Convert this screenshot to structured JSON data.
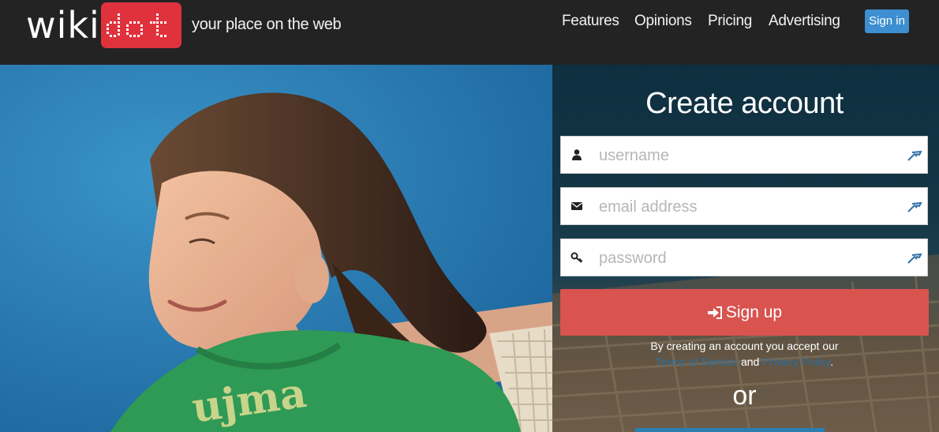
{
  "header": {
    "logo_wiki": "wiki",
    "logo_dot": "dot",
    "tagline": "your place on the web",
    "nav": [
      "Features",
      "Opinions",
      "Pricing",
      "Advertising"
    ],
    "signin_label": "Sign in"
  },
  "hero": {
    "shirt_text": "ujma"
  },
  "signup": {
    "title": "Create account",
    "username_placeholder": "username",
    "email_placeholder": "email address",
    "password_placeholder": "password",
    "button_label": "Sign up",
    "terms_text": "By creating an account you accept our",
    "terms_link": "Terms of Service",
    "terms_and": "and",
    "privacy_link": "Privacy Policy",
    "terms_end": ".",
    "or_text": "or"
  },
  "colors": {
    "header_bg": "#232323",
    "logo_red": "#e0323c",
    "signin_blue": "#3d8fd1",
    "signup_red": "#d9534f",
    "link_blue": "#2a6fa3"
  },
  "icons": {
    "username": "user-icon",
    "email": "envelope-icon",
    "password": "key-icon",
    "password_manager": "password-manager-icon",
    "signup": "sign-in-arrow-icon"
  }
}
